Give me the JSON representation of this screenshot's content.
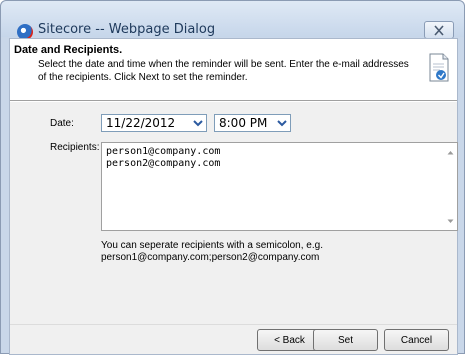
{
  "window": {
    "title": "Sitecore -- Webpage Dialog",
    "icons": {
      "app": "sitecore-globe-icon",
      "close": "close-icon"
    }
  },
  "header": {
    "title": "Date and Recipients.",
    "description": "Select the date and time when the reminder will be sent. Enter the e-mail addresses of the recipients. Click Next to set the reminder.",
    "icon": "document-reminder-icon"
  },
  "form": {
    "date_label": "Date:",
    "date_value": "11/22/2012",
    "time_value": "8:00 PM",
    "recipients_label": "Recipients:",
    "recipients": [
      "person1@company.com",
      "person2@company.com"
    ],
    "hint_line1": "You can seperate recipients with a semicolon, e.g.",
    "hint_line2": "person1@company.com;person2@company.com"
  },
  "buttons": {
    "back": "< Back",
    "set": "Set",
    "cancel": "Cancel"
  },
  "colors": {
    "titlebar": "#c9d7e9",
    "title_text": "#1e395b",
    "dialog_body": "#f0f0f0"
  }
}
